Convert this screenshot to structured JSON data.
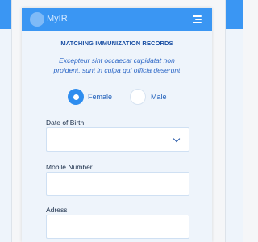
{
  "app": {
    "logo_text": "MyIR"
  },
  "page": {
    "title": "MATCHING IMMUNIZATION RECORDS",
    "description": "Excepteur sint occaecat cupidatat non proident, sunt in culpa qui officia deserunt"
  },
  "gender": {
    "options": [
      {
        "label": "Female",
        "selected": true
      },
      {
        "label": "Male",
        "selected": false
      }
    ]
  },
  "form": {
    "dob_label": "Date of Birth",
    "dob_value": "",
    "mobile_label": "Mobile Number",
    "mobile_value": "",
    "address_label": "Adress",
    "address_value": ""
  },
  "colors": {
    "accent": "#3a96f3",
    "title_text": "#1a4fa3",
    "background": "#eef4fb"
  }
}
